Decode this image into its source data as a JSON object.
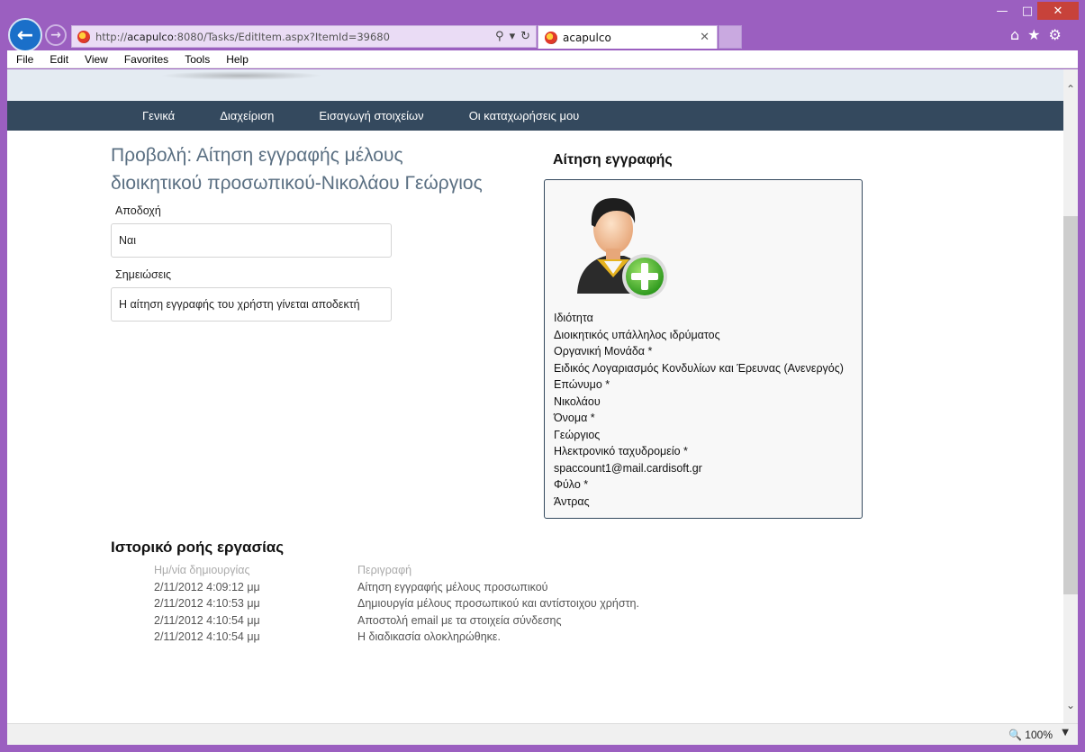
{
  "browser": {
    "url_prefix": "http://",
    "url_host": "acapulco",
    "url_rest": ":8080/Tasks/EditItem.aspx?ItemId=39680",
    "tab_title": "acapulco",
    "zoom": "100%"
  },
  "menu": [
    "File",
    "Edit",
    "View",
    "Favorites",
    "Tools",
    "Help"
  ],
  "nav": [
    "Γενικά",
    "Διαχείριση",
    "Εισαγωγή στοιχείων",
    "Οι καταχωρήσεις μου"
  ],
  "form": {
    "title_line1": "Προβολή: Αίτηση εγγραφής μέλους",
    "title_line2": "διοικητικού προσωπικού-Νικολάου Γεώργιος",
    "acceptance_label": "Αποδοχή",
    "acceptance_value": "Ναι",
    "notes_label": "Σημειώσεις",
    "notes_value": "Η αίτηση εγγραφής του χρήστη γίνεται αποδεκτή"
  },
  "card": {
    "title": "Αίτηση εγγραφής",
    "lines": [
      "Ιδιότητα",
      "Διοικητικός υπάλληλος ιδρύματος",
      "Οργανική Μονάδα *",
      "Ειδικός Λογαριασμός Κονδυλίων και Έρευνας (Ανενεργός)",
      "Επώνυμο *",
      "Νικολάου",
      "Όνομα *",
      "Γεώργιος",
      "Ηλεκτρονικό ταχυδρομείο *",
      "spaccount1@mail.cardisoft.gr",
      "Φύλο *",
      "Άντρας"
    ]
  },
  "history": {
    "title": "Ιστορικό ροής εργασίας",
    "headers": [
      "Ημ/νία δημιουργίας",
      "Περιγραφή"
    ],
    "rows": [
      [
        "2/11/2012 4:09:12 μμ",
        "Αίτηση εγγραφής μέλους προσωπικού"
      ],
      [
        "2/11/2012 4:10:53 μμ",
        "Δημιουργία μέλους προσωπικού και αντίστοιχου χρήστη."
      ],
      [
        "2/11/2012 4:10:54 μμ",
        "Αποστολή email με τα στοιχεία σύνδεσης"
      ],
      [
        "2/11/2012 4:10:54 μμ",
        "Η διαδικασία ολοκληρώθηκε."
      ]
    ]
  }
}
